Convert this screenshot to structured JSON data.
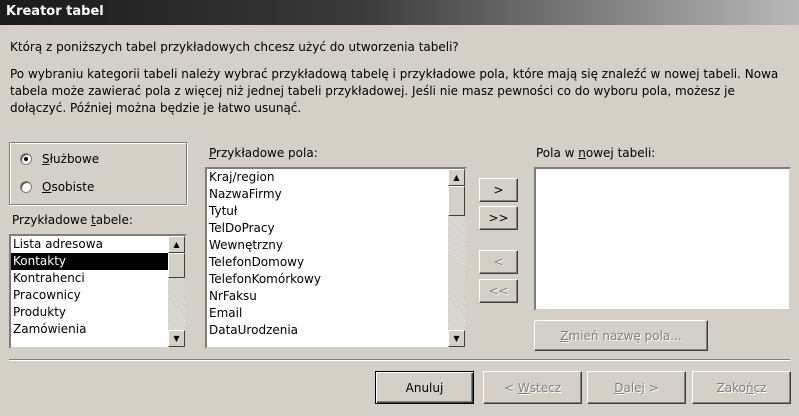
{
  "window": {
    "title": "Kreator tabel"
  },
  "question": "Którą z poniższych tabel przykładowych chcesz użyć do utworzenia tabeli?",
  "description": "Po wybraniu kategorii tabeli należy wybrać przykładową tabelę i przykładowe pola, które mają się znaleźć w nowej tabeli. Nowa tabela może zawierać pola z więcej niż jednej tabeli przykładowej. Jeśli nie masz pewności co do wyboru pola, możesz je dołączyć. Później można będzie je łatwo usunąć.",
  "category": {
    "options": [
      {
        "access": "S",
        "rest": "łużbowe",
        "selected": true
      },
      {
        "access": "O",
        "rest": "sobiste",
        "selected": false
      }
    ]
  },
  "sample_tables": {
    "label_pre": "Przykładowe ",
    "label_access": "t",
    "label_post": "abele:",
    "items": [
      "Lista adresowa",
      "Kontakty",
      "Kontrahenci",
      "Pracownicy",
      "Produkty",
      "Zamówienia"
    ],
    "selected_index": 1
  },
  "sample_fields": {
    "label_access": "P",
    "label_post": "rzykładowe pola:",
    "items": [
      "Kraj/region",
      "NazwaFirmy",
      "Tytuł",
      "TelDoPracy",
      "Wewnętrzny",
      "TelefonDomowy",
      "TelefonKomórkowy",
      "NrFaksu",
      "Email",
      "DataUrodzenia"
    ]
  },
  "new_fields": {
    "label_pre": "Pola w ",
    "label_access": "n",
    "label_post": "owej tabeli:",
    "items": []
  },
  "transfer_buttons": {
    "add_one": ">",
    "add_all": ">>",
    "remove_one": "<",
    "remove_all": "<<"
  },
  "rename_button": {
    "access": "Z",
    "rest": "mień nazwę pola..."
  },
  "footer": {
    "cancel": "Anuluj",
    "back_pre": "< ",
    "back_access": "W",
    "back_post": "stecz",
    "next_access": "D",
    "next_post": "alej >",
    "finish_pre": "Zako",
    "finish_access": "ń",
    "finish_post": "cz"
  }
}
